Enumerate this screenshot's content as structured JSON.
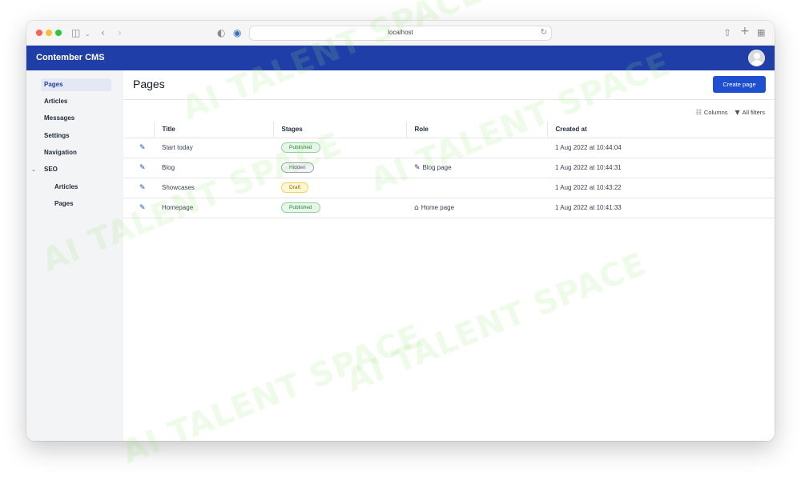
{
  "browser": {
    "address": "localhost",
    "icons": {
      "sidebar_toggle": "sidebar-toggle-icon",
      "back": "chevron-left-icon",
      "forward": "chevron-right-icon",
      "shield": "privacy-shield-icon",
      "extension": "extension-icon",
      "reload": "reload-icon",
      "share": "share-icon",
      "new_tab": "plus-icon",
      "tab_overview": "tab-grid-icon"
    }
  },
  "app": {
    "brand": "Contember CMS",
    "colors": {
      "appbar": "#1f3ea8",
      "primary_button": "#1f4fd1"
    }
  },
  "sidebar": {
    "items": [
      {
        "label": "Pages",
        "active": true
      },
      {
        "label": "Articles"
      },
      {
        "label": "Messages"
      },
      {
        "label": "Settings"
      },
      {
        "label": "Navigation"
      },
      {
        "label": "SEO",
        "expanded": true
      },
      {
        "label": "Articles",
        "child": true
      },
      {
        "label": "Pages",
        "child": true
      }
    ]
  },
  "main": {
    "title": "Pages",
    "create_button": "Create page",
    "columns_label": "Columns",
    "filters_label": "All filters",
    "table": {
      "headers": [
        "",
        "Title",
        "Stages",
        "Role",
        "Created at"
      ],
      "rows": [
        {
          "title": "Start today",
          "stage": "Published",
          "role": "",
          "created": "1 Aug 2022 at 10:44:04"
        },
        {
          "title": "Blog",
          "stage": "Hidden",
          "role": "Blog page",
          "role_icon": "edit-square-icon",
          "created": "1 Aug 2022 at 10:44:31"
        },
        {
          "title": "Showcases",
          "stage": "Draft",
          "role": "",
          "created": "1 Aug 2022 at 10:43:22"
        },
        {
          "title": "Homepage",
          "stage": "Published",
          "role": "Home page",
          "role_icon": "home-icon",
          "created": "1 Aug 2022 at 10:41:33"
        }
      ]
    }
  },
  "watermark": "AI TALENT SPACE"
}
